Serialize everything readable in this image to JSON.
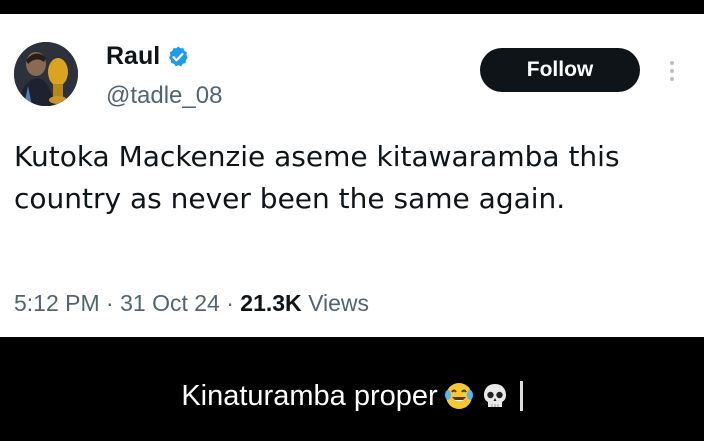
{
  "tweet": {
    "author_name": "Raul",
    "handle": "@tadle_08",
    "verified": true,
    "follow_label": "Follow",
    "text": "Kutoka Mackenzie aseme kitawaramba this country as never been the same again.",
    "time": "5:12 PM",
    "date": "31 Oct 24",
    "separator": "·",
    "views_count": "21.3K",
    "views_label": "Views"
  },
  "caption": {
    "text": "Kinaturamba proper",
    "emojis": [
      "face-with-tears-of-joy-icon",
      "skull-icon"
    ]
  },
  "colors": {
    "verified_blue": "#1d9bf0",
    "follow_bg": "#0f1419",
    "muted_text": "#536471"
  }
}
